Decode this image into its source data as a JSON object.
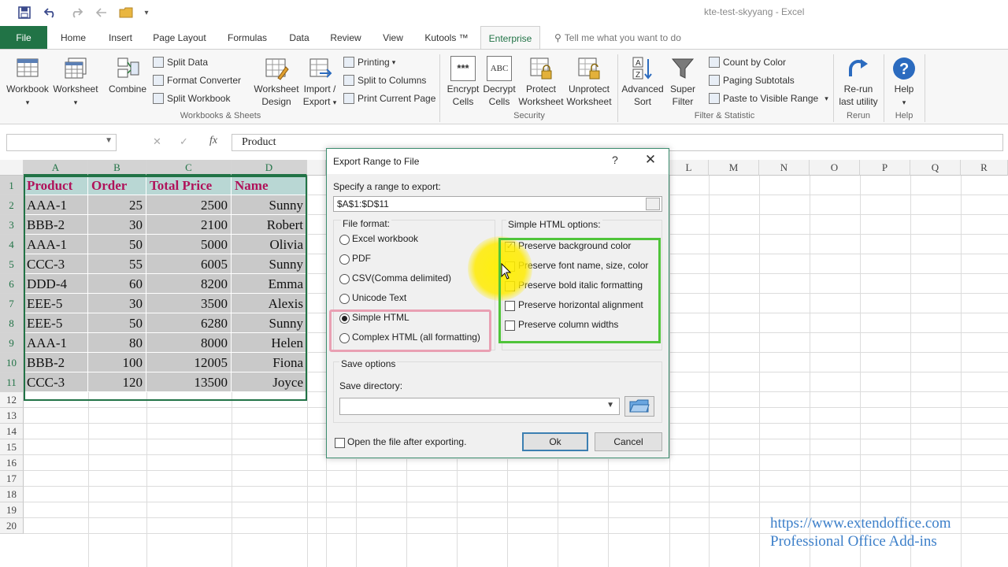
{
  "window": {
    "title": "kte-test-skyyang  -  Excel"
  },
  "tabs": [
    "File",
    "Home",
    "Insert",
    "Page Layout",
    "Formulas",
    "Data",
    "Review",
    "View",
    "Kutools ™",
    "Enterprise"
  ],
  "tell_me": "Tell me what you want to do",
  "ribbon": {
    "workbook": "Workbook",
    "worksheet": "Worksheet",
    "combine": "Combine",
    "split_data": "Split Data",
    "format_converter": "Format Converter",
    "split_workbook": "Split Workbook",
    "worksheet_design_1": "Worksheet",
    "worksheet_design_2": "Design",
    "import_export_1": "Import /",
    "import_export_2": "Export",
    "printing": "Printing",
    "split_to_columns": "Split to Columns",
    "print_current_page": "Print Current Page",
    "group_workbooks": "Workbooks & Sheets",
    "encrypt_1": "Encrypt",
    "encrypt_2": "Cells",
    "decrypt_1": "Decrypt",
    "decrypt_2": "Cells",
    "protect_1": "Protect",
    "protect_2": "Worksheet",
    "unprotect_1": "Unprotect",
    "unprotect_2": "Worksheet",
    "group_security": "Security",
    "advanced_sort_1": "Advanced",
    "advanced_sort_2": "Sort",
    "super_filter_1": "Super",
    "super_filter_2": "Filter",
    "count_by_color": "Count by Color",
    "paging_subtotals": "Paging Subtotals",
    "paste_visible": "Paste to Visible Range",
    "group_filter": "Filter & Statistic",
    "rerun_1": "Re-run",
    "rerun_2": "last utility",
    "group_rerun": "Rerun",
    "help": "Help",
    "group_help": "Help",
    "icon_encrypt": "***",
    "icon_decrypt": "ABC"
  },
  "formula_bar": {
    "fx": "fx",
    "content": "Product"
  },
  "columns": [
    "A",
    "B",
    "C",
    "D",
    "L",
    "M",
    "N",
    "O",
    "P",
    "Q",
    "R"
  ],
  "rows": [
    "1",
    "2",
    "3",
    "4",
    "5",
    "6",
    "7",
    "8",
    "9",
    "10",
    "11",
    "12",
    "13",
    "14",
    "15",
    "16",
    "17",
    "18",
    "19",
    "20"
  ],
  "table": {
    "header": [
      "Product",
      "Order",
      "Total Price",
      "Name"
    ],
    "rows": [
      [
        "AAA-1",
        "25",
        "2500",
        "Sunny"
      ],
      [
        "BBB-2",
        "30",
        "2100",
        "Robert"
      ],
      [
        "AAA-1",
        "50",
        "5000",
        "Olivia"
      ],
      [
        "CCC-3",
        "55",
        "6005",
        "Sunny"
      ],
      [
        "DDD-4",
        "60",
        "8200",
        "Emma"
      ],
      [
        "EEE-5",
        "30",
        "3500",
        "Alexis"
      ],
      [
        "EEE-5",
        "50",
        "6280",
        "Sunny"
      ],
      [
        "AAA-1",
        "80",
        "8000",
        "Helen"
      ],
      [
        "BBB-2",
        "100",
        "12005",
        "Fiona"
      ],
      [
        "CCC-3",
        "120",
        "13500",
        "Joyce"
      ]
    ]
  },
  "dialog": {
    "title": "Export Range to File",
    "help": "?",
    "close": "✕",
    "range_label": "Specify a range to export:",
    "range_value": "$A$1:$D$11",
    "file_format_label": "File format:",
    "formats": [
      "Excel workbook",
      "PDF",
      "CSV(Comma delimited)",
      "Unicode Text",
      "Simple HTML",
      "Complex HTML (all formatting)"
    ],
    "selected_format": "Simple HTML",
    "html_options_label": "Simple HTML options:",
    "options": [
      {
        "label": "Preserve background color",
        "checked": true
      },
      {
        "label": "Preserve font name, size, color",
        "checked": false
      },
      {
        "label": "Preserve bold italic formatting",
        "checked": false
      },
      {
        "label": "Preserve horizontal alignment",
        "checked": false
      },
      {
        "label": "Preserve column widths",
        "checked": false
      }
    ],
    "save_options_label": "Save options",
    "save_dir_label": "Save directory:",
    "open_after_label": "Open the file after exporting.",
    "ok": "Ok",
    "cancel": "Cancel"
  },
  "watermark": {
    "url": "https://www.extendoffice.com",
    "tagline": "Professional Office Add-ins"
  },
  "colors": {
    "excel_green": "#217346",
    "header_text": "#b0125a",
    "header_bg": "#b9d7d4",
    "cell_bg": "#c9c9c9",
    "highlight_pink": "#e9a0b3",
    "highlight_green": "#4fc43a",
    "watermark": "#3c7fc9"
  }
}
